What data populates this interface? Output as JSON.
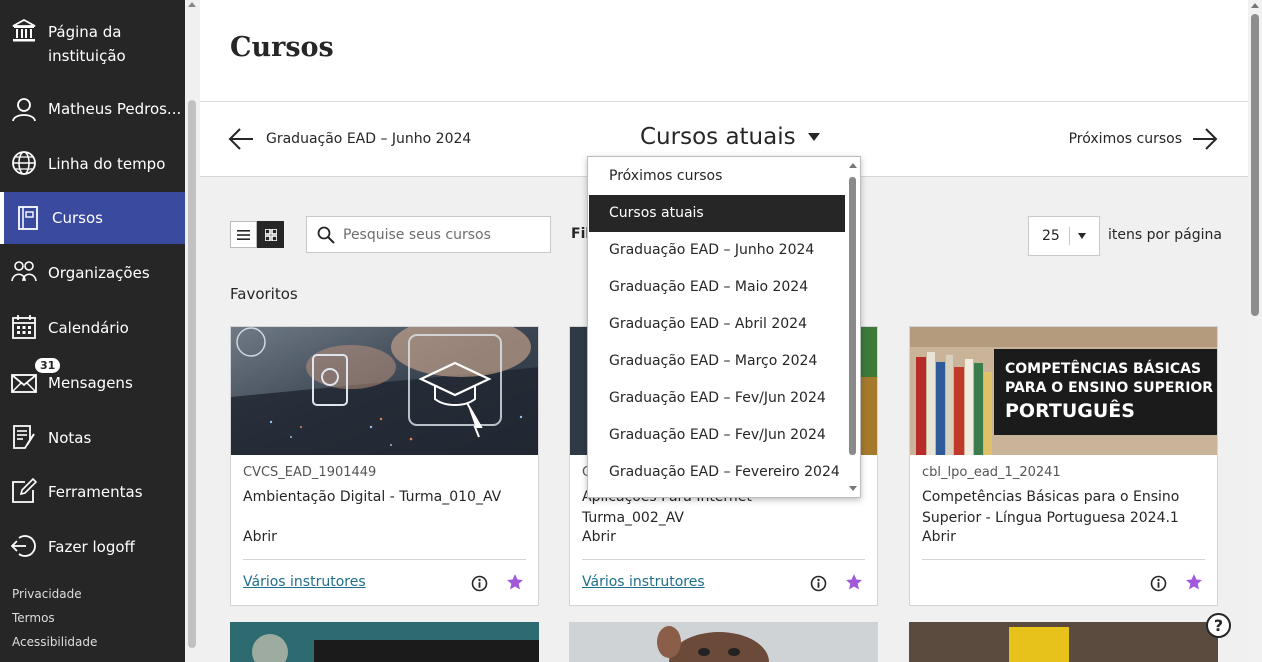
{
  "sidebar": {
    "items": [
      {
        "label": "Página da\ninstituição",
        "icon": "institution-icon"
      },
      {
        "label": "Matheus Pedros...",
        "icon": "user-icon"
      },
      {
        "label": "Linha do tempo",
        "icon": "globe-icon"
      },
      {
        "label": "Cursos",
        "icon": "courses-icon"
      },
      {
        "label": "Organizações",
        "icon": "organizations-icon"
      },
      {
        "label": "Calendário",
        "icon": "calendar-icon"
      },
      {
        "label": "Mensagens",
        "icon": "mail-icon",
        "badge": "31"
      },
      {
        "label": "Notas",
        "icon": "grades-icon"
      },
      {
        "label": "Ferramentas",
        "icon": "tools-icon"
      },
      {
        "label": "Fazer logoff",
        "icon": "logout-icon"
      }
    ],
    "footer": [
      "Privacidade",
      "Termos",
      "Acessibilidade"
    ]
  },
  "page": {
    "title": "Cursos"
  },
  "term_nav": {
    "prev": "Graduação EAD – Junho 2024",
    "current": "Cursos atuais",
    "next": "Próximos cursos"
  },
  "dropdown": {
    "options": [
      "Próximos cursos",
      "Cursos atuais",
      "Graduação EAD – Junho 2024",
      "Graduação EAD – Maio 2024",
      "Graduação EAD – Abril 2024",
      "Graduação EAD – Março 2024",
      "Graduação EAD – Fev/Jun 2024",
      "Graduação EAD – Fev/Jun 2024",
      "Graduação EAD – Fevereiro 2024"
    ],
    "selected_index": 1
  },
  "toolbar": {
    "search_placeholder": "Pesquise seus cursos",
    "filter_label": "Fil",
    "per_page_value": "25",
    "per_page_label": "itens por página"
  },
  "favorites": {
    "title": "Favoritos",
    "cards": [
      {
        "code": "CVCS_EAD_1901449",
        "name": "Ambientação Digital - Turma_010_AV",
        "open": "Abrir",
        "instructors": "Vários instrutores"
      },
      {
        "code": "C",
        "name": "Aplicações Para Internet - Turma_002_AV",
        "open": "Abrir",
        "instructors": "Vários instrutores"
      },
      {
        "code": "cbl_lpo_ead_1_20241",
        "name": "Competências Básicas para o Ensino Superior - Língua Portuguesa 2024.1",
        "open": "Abrir",
        "instructors": ""
      }
    ],
    "banner": {
      "line1": "COMPETÊNCIAS BÁSICAS",
      "line2": "PARA O ENSINO SUPERIOR",
      "line3": "PORTUGUÊS"
    }
  },
  "colors": {
    "sidebar": "#262626",
    "active": "#3a4a9f",
    "star": "#a259d9",
    "link": "#1f6f8b"
  }
}
